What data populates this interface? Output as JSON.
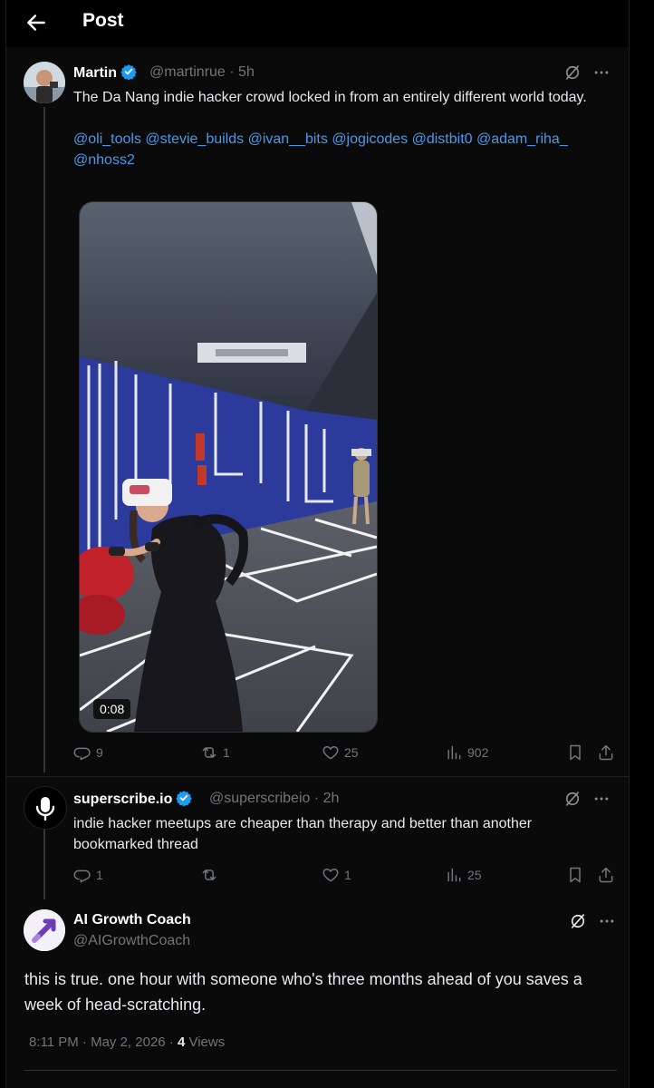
{
  "header": {
    "title": "Post"
  },
  "posts": [
    {
      "name": "Martin",
      "handle": "@martinrue",
      "time": "· 5h",
      "text": "The Da Nang indie hacker crowd locked in from an entirely different world today.",
      "mentions_line1": "@oli_tools @stevie_builds @ivan__bits @jogicodes @distbit0 @adam_riha_",
      "mentions_line2": "@nhoss2",
      "video_duration": "0:08",
      "stats": {
        "replies": "9",
        "reposts": "1",
        "likes": "25",
        "views": "902"
      }
    },
    {
      "name": "superscribe.io",
      "handle": "@superscribeio",
      "time": "· 2h",
      "text": "indie hacker meetups are cheaper than therapy and better than another bookmarked thread",
      "stats": {
        "replies": "1",
        "reposts": "",
        "likes": "1",
        "views": "25"
      }
    }
  ],
  "focused": {
    "name": "AI Growth Coach",
    "handle": "@AIGrowthCoach",
    "text": "this is true. one hour with someone who's three months ahead of you saves a week of head-scratching.",
    "timestamp": "8:11 PM · May 2, 2026 ·",
    "views_count": "4",
    "views_label": "Views"
  },
  "colors": {
    "background": "#000000",
    "link": "#4a99e9",
    "verified": "#1d9bf0",
    "muted": "#71767b"
  }
}
